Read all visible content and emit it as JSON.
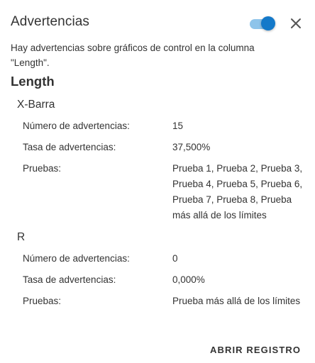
{
  "dialog": {
    "title": "Advertencias",
    "toggle_on": true,
    "accent_color": "#1479c9",
    "message": "Hay advertencias sobre gráficos de control en la columna \"Length\"."
  },
  "section": {
    "title": "Length"
  },
  "charts": [
    {
      "name": "X-Barra",
      "rows": [
        {
          "label": "Número de advertencias:",
          "value": "15"
        },
        {
          "label": "Tasa de advertencias:",
          "value": "37,500%"
        },
        {
          "label": "Pruebas:",
          "value": "Prueba 1, Prueba 2, Prueba 3, Prueba 4, Prueba 5, Prueba 6, Prueba 7, Prueba 8, Prueba más allá de los límites"
        }
      ]
    },
    {
      "name": "R",
      "rows": [
        {
          "label": "Número de advertencias:",
          "value": "0"
        },
        {
          "label": "Tasa de advertencias:",
          "value": "0,000%"
        },
        {
          "label": "Pruebas:",
          "value": "Prueba más allá de los límites"
        }
      ]
    }
  ],
  "footer": {
    "open_log_label": "ABRIR REGISTRO"
  }
}
